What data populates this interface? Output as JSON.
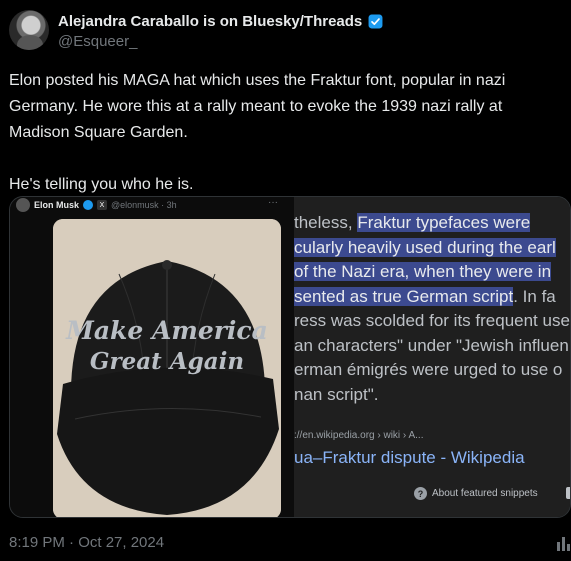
{
  "author": {
    "display_name": "Alejandra Caraballo is on Bluesky/Threads",
    "handle": "@Esqueer_",
    "verified_color": "#1d9bf0"
  },
  "tweet": {
    "text": "Elon posted his MAGA hat which uses the Fraktur font, popular in nazi Germany. He wore this at a rally meant to evoke the 1939 nazi rally at Madison Square Garden.\n\nHe's telling you who he is.",
    "timestamp": "8:19 PM · Oct 27, 2024"
  },
  "embedded_post": {
    "name": "Elon Musk",
    "x_badge": "X",
    "handle_time": "@elonmusk · 3h",
    "more": "···",
    "hat_text_line1": "Make America",
    "hat_text_line2": "Great Again"
  },
  "snippet": {
    "lines": [
      {
        "pre": "theless, ",
        "hl": "Fraktur typefaces were",
        "post": ""
      },
      {
        "pre": "",
        "hl": "cularly heavily used during the earl",
        "post": ""
      },
      {
        "pre": "",
        "hl": " of the Nazi era, when they were in",
        "post": ""
      },
      {
        "pre": "",
        "hl": "sented as true German script",
        "post": ". In fa"
      },
      {
        "pre": "ress was scolded for its frequent use",
        "hl": "",
        "post": ""
      },
      {
        "pre": "an characters\" under \"Jewish influen",
        "hl": "",
        "post": ""
      },
      {
        "pre": "erman émigrés were urged to use o",
        "hl": "",
        "post": ""
      },
      {
        "pre": "nan script\".",
        "hl": "",
        "post": ""
      }
    ],
    "source_url": "://en.wikipedia.org › wiki › A...",
    "link_text": "ua–Fraktur dispute - Wikipedia",
    "about_label": "About featured snippets",
    "help_icon": "?"
  },
  "colors": {
    "background": "#000000",
    "highlight": "#3c4a8f",
    "link": "#8ab4f8"
  }
}
